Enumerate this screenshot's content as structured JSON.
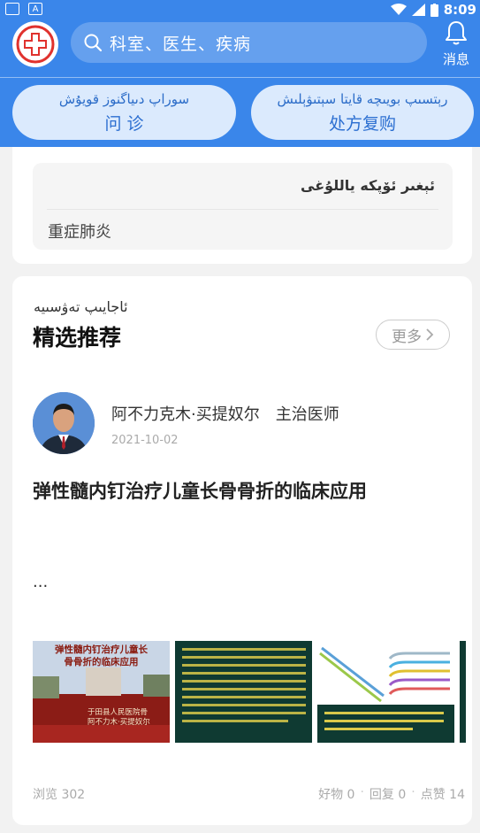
{
  "status_bar": {
    "time": "8:09"
  },
  "header": {
    "search_placeholder": "科室、医生、疾病",
    "message_label": "消息"
  },
  "quick_actions": [
    {
      "label_ug": "سوراپ دىياگنوز قويۇش",
      "label_cn": "问 诊"
    },
    {
      "label_ug": "رېتسىپ بويىچە قايتا سېتىۋېلىش",
      "label_cn": "处方复购"
    }
  ],
  "disease_card": {
    "title_ug": "ئېغىر ئۆپكە ياللۇغى",
    "item_cn": "重症肺炎"
  },
  "recommend": {
    "title_ug": "ئاجايىپ تەۋسىيە",
    "title_cn": "精选推荐",
    "more_label": "更多",
    "doctor_line": "阿不力克木·买提奴尔　主治医师",
    "date": "2021-10-02",
    "article_title": "弹性髓内钉治疗儿童长骨骨折的临床应用",
    "excerpt": "...",
    "thumb1_caption_1": "弹性髓内钉治疗儿童长",
    "thumb1_caption_2": "骨骨折的临床应用",
    "thumb1_caption_3": "于田县人民医院骨",
    "thumb1_caption_4": "阿不力木·买提奴尔",
    "views": "浏览 302",
    "likes_text": "好物 0",
    "replies_text": "回复 0",
    "praise_text": "点赞 14"
  },
  "colors": {
    "primary": "#3a86ea",
    "pill_bg": "#dbeafd",
    "logo_red": "#e0322e"
  }
}
